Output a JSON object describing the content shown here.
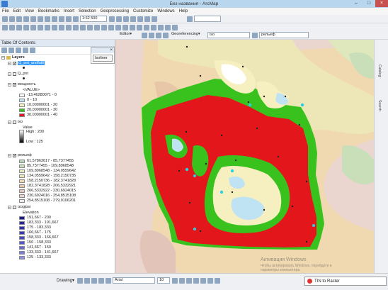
{
  "window": {
    "title": "Без названия - ArcMap"
  },
  "menu": [
    "File",
    "Edit",
    "View",
    "Bookmarks",
    "Insert",
    "Selection",
    "Geoprocessing",
    "Customize",
    "Windows",
    "Help"
  ],
  "toolbar": {
    "scale": "1:62 500",
    "editor": "Editor▾",
    "georef": "Georeferencing▾",
    "georef_layer": "iso",
    "layer_select": "рельеф"
  },
  "toc": {
    "title": "Table Of Contents",
    "isoliner": "Isoliner",
    "root": "Layers",
    "layers": [
      {
        "name": "Q_pnt_andfutil"
      },
      {
        "name": "Q_pnt"
      },
      {
        "name": "мощность"
      },
      {
        "name": "iso"
      },
      {
        "name": "рельеф"
      },
      {
        "name": "izogipsi"
      }
    ],
    "moshnost": {
      "field": "<VALUE>",
      "classes": [
        {
          "label": "-13,46280071 - 0",
          "color": "#ffffff"
        },
        {
          "label": "0 - 10",
          "color": "#bfe3f2"
        },
        {
          "label": "10,00000001 - 20",
          "color": "#f6f0c0"
        },
        {
          "label": "20,00000001 - 30",
          "color": "#39c21e"
        },
        {
          "label": "30,00000001 - 40",
          "color": "#e3171b"
        }
      ]
    },
    "iso": {
      "value": "Value",
      "high": "High : 200",
      "low": "Low : 125"
    },
    "relief": {
      "classes": [
        {
          "label": "61,57863617 - 85,7377455",
          "color": "#b8d6bb"
        },
        {
          "label": "85,7377455 - 109,8968548",
          "color": "#c9dfb9"
        },
        {
          "label": "109,8968548 - 134,0559642",
          "color": "#dfe8bd"
        },
        {
          "label": "134,0559642 - 158,2150735",
          "color": "#ede7b8"
        },
        {
          "label": "158,2150736 - 182,3741828",
          "color": "#f0d9b0"
        },
        {
          "label": "182,3741828 - 206,5332921",
          "color": "#e8c7a8"
        },
        {
          "label": "206,5332922 - 230,6924015",
          "color": "#e3c4b8"
        },
        {
          "label": "230,6924016 - 254,8515108",
          "color": "#ead4cf"
        },
        {
          "label": "254,8515108 - 279,0106201",
          "color": "#f2e8e6"
        }
      ]
    },
    "izogipsi": {
      "field": "Elevation",
      "classes": [
        {
          "label": "191,667 - 200",
          "color": "#1a1a8c"
        },
        {
          "label": "183,333 - 191,667",
          "color": "#23239a"
        },
        {
          "label": "175 - 183,333",
          "color": "#2f2faa"
        },
        {
          "label": "166,667 - 175",
          "color": "#3a3ab8"
        },
        {
          "label": "158,333 - 166,667",
          "color": "#4747c4"
        },
        {
          "label": "150 - 158,333",
          "color": "#5656cc"
        },
        {
          "label": "141,667 - 150",
          "color": "#6868d4"
        },
        {
          "label": "133,333 - 141,667",
          "color": "#7b7bdb"
        },
        {
          "label": "125 - 133,333",
          "color": "#8f8fe2"
        }
      ]
    }
  },
  "rightbar": [
    "Catalog",
    "Search"
  ],
  "draw_toolbar": {
    "drawing": "Drawing▾",
    "font": "Arial",
    "size": "10"
  },
  "toast": {
    "label": "TIN to Raster"
  },
  "watermark": {
    "line1": "Активация Windows",
    "line2": "Чтобы активировать Windows, перейдите в",
    "line3": "параметры компьютера."
  }
}
